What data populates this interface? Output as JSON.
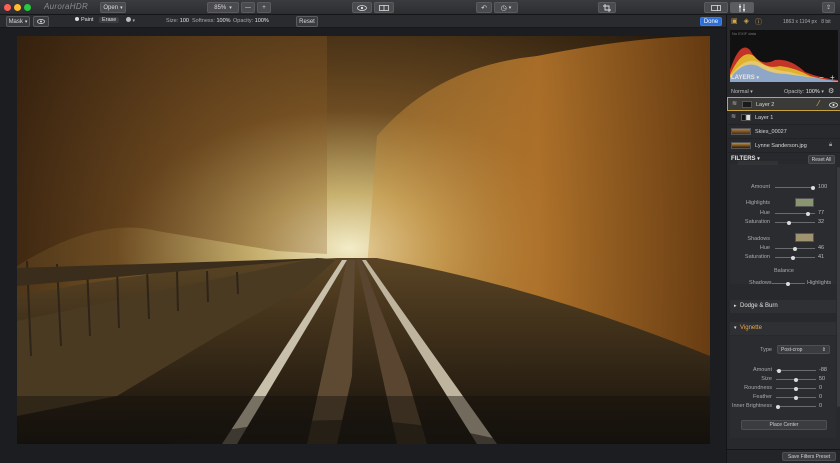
{
  "app": {
    "logo": "AuroraHDR",
    "open_label": "Open",
    "zoom_value": "85%",
    "zoom_minus": "—",
    "zoom_plus": "+"
  },
  "toolbar": {
    "mask_label": "Mask",
    "paint_label": "Paint",
    "erase_label": "Erase",
    "size_label": "Size:",
    "size_value": "100",
    "softness_label": "Softness:",
    "softness_value": "100%",
    "opacity_label": "Opacity:",
    "opacity_value": "100%",
    "reset_label": "Reset",
    "done_label": "Done"
  },
  "histogram": {
    "exif_text": "No EXIF data",
    "dimensions": "1863 x 1104 px",
    "bits": "8 bit"
  },
  "layers": {
    "header": "LAYERS",
    "blend_mode": "Normal",
    "opacity_label": "Opacity:",
    "opacity_value": "100%",
    "items": [
      {
        "name": "Layer 2"
      },
      {
        "name": "Layer 1"
      },
      {
        "name": "Skies_00027"
      },
      {
        "name": "Lynne Sanderson.jpg"
      }
    ]
  },
  "filters": {
    "header": "FILTERS",
    "reset_all_label": "Reset All",
    "color_toning": {
      "amount_label": "Amount",
      "amount_value": "100",
      "highlights_label": "Highlights",
      "highlights_color": "#8a9670",
      "h_hue_label": "Hue",
      "h_hue_value": "77",
      "h_sat_label": "Saturation",
      "h_sat_value": "32",
      "shadows_label": "Shadows",
      "shadows_color": "#a09470",
      "s_hue_label": "Hue",
      "s_hue_value": "46",
      "s_sat_label": "Saturation",
      "s_sat_value": "41",
      "balance_label": "Balance",
      "balance_left": "Shadows",
      "balance_right": "Highlights"
    },
    "dodge_burn_label": "Dodge & Burn",
    "vignette": {
      "title": "Vignette",
      "type_label": "Type",
      "type_value": "Post-crop",
      "amount_label": "Amount",
      "amount_value": "-88",
      "size_label": "Size",
      "size_value": "50",
      "roundness_label": "Roundness",
      "roundness_value": "0",
      "feather_label": "Feather",
      "feather_value": "0",
      "inner_label": "Inner Brightness",
      "inner_value": "0",
      "place_center_label": "Place Center"
    },
    "save_preset_label": "Save Filters Preset"
  }
}
